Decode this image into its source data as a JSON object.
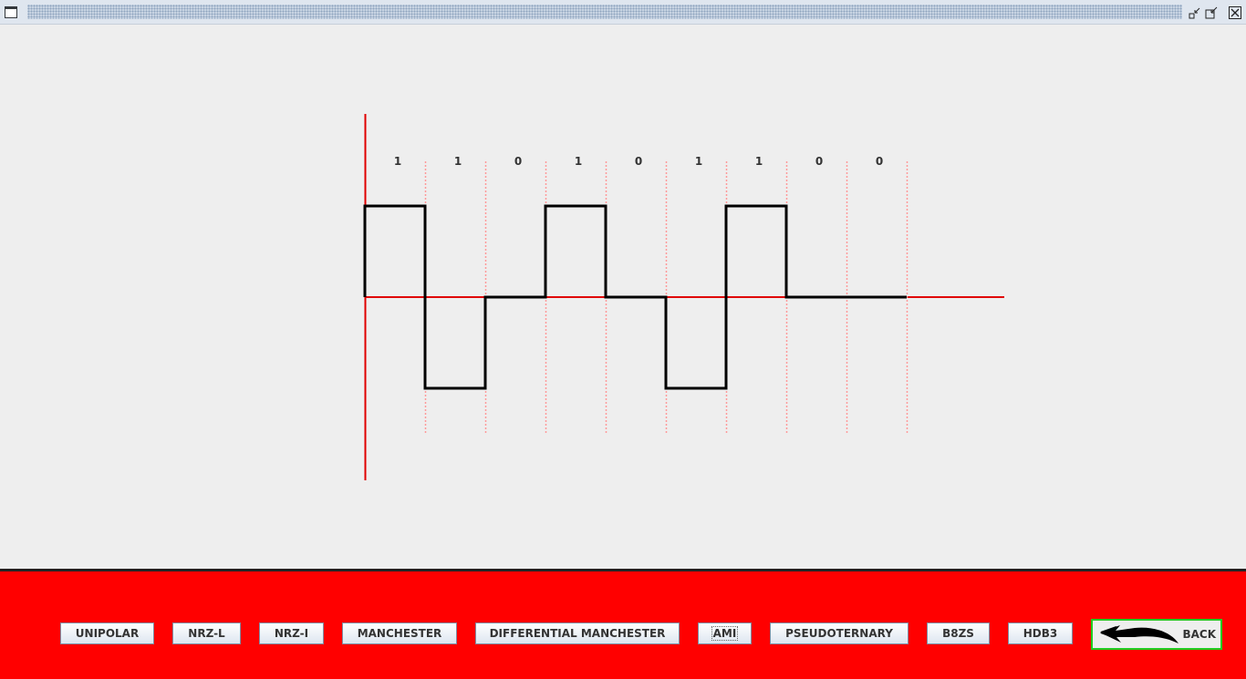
{
  "window": {
    "controls": [
      "minimize-icon",
      "maximize-icon",
      "close-icon"
    ]
  },
  "chart_data": {
    "type": "line",
    "bits": [
      "1",
      "1",
      "0",
      "1",
      "0",
      "1",
      "1",
      "0",
      "0"
    ],
    "levels": [
      1,
      -1,
      0,
      1,
      0,
      -1,
      1,
      0,
      0
    ],
    "ylim": [
      -2,
      2
    ],
    "colors": {
      "signal": "#000000",
      "axis": "#e00000",
      "grid": "#ff9a9a"
    }
  },
  "encodings": [
    {
      "id": "unipolar",
      "label": "UNIPOLAR"
    },
    {
      "id": "nrz-l",
      "label": "NRZ-L"
    },
    {
      "id": "nrz-i",
      "label": "NRZ-I"
    },
    {
      "id": "manchester",
      "label": "MANCHESTER"
    },
    {
      "id": "differential-manchester",
      "label": "DIFFERENTIAL MANCHESTER"
    },
    {
      "id": "ami",
      "label": "AMI"
    },
    {
      "id": "pseudoternary",
      "label": "PSEUDOTERNARY"
    },
    {
      "id": "b8zs",
      "label": "B8ZS"
    },
    {
      "id": "hdb3",
      "label": "HDB3"
    }
  ],
  "back": {
    "label": "BACK",
    "icon": "back-arrow-icon",
    "border_color": "#22cc22"
  },
  "colors": {
    "panel": "#ff0000",
    "background": "#eeeeee"
  }
}
